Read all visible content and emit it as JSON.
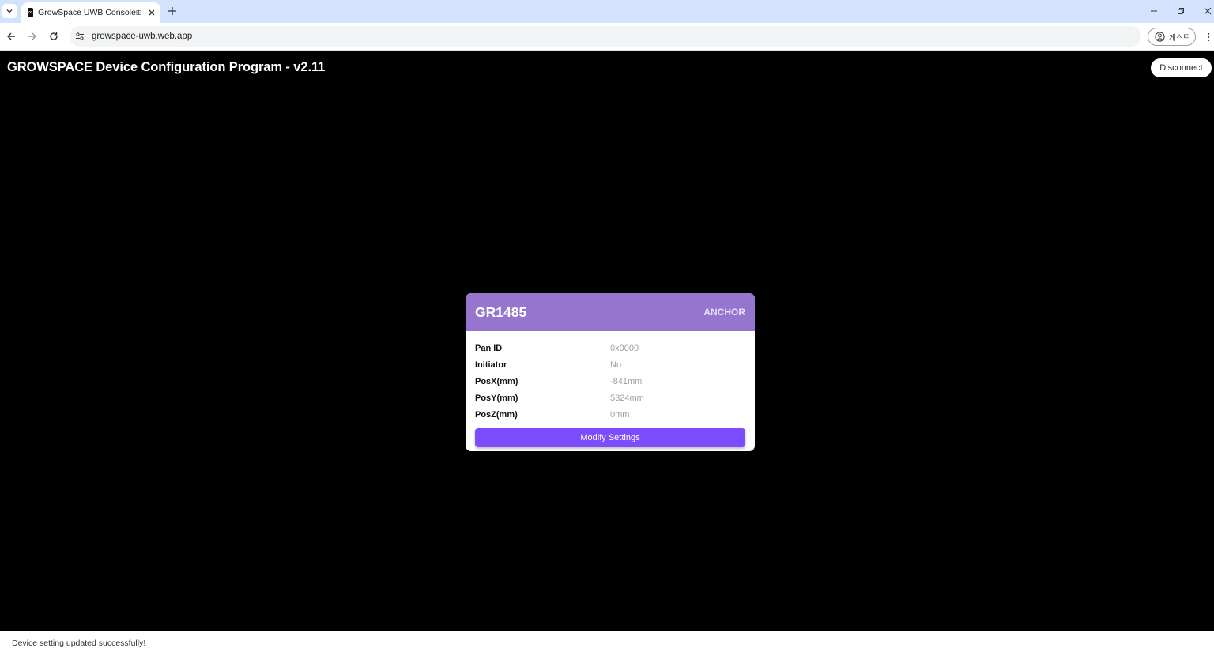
{
  "browser": {
    "tab_title": "GrowSpace UWB Console",
    "url": "growspace-uwb.web.app",
    "profile_label": "게스트",
    "favicon_glyph": "∞"
  },
  "app": {
    "title": "GROWSPACE Device Configuration Program - v2.11",
    "disconnect_label": "Disconnect"
  },
  "device": {
    "id": "GR1485",
    "role": "ANCHOR",
    "fields": [
      {
        "label": "Pan ID",
        "value": "0x0000"
      },
      {
        "label": "Initiator",
        "value": "No"
      },
      {
        "label": "PosX(mm)",
        "value": "-841mm"
      },
      {
        "label": "PosY(mm)",
        "value": "5324mm"
      },
      {
        "label": "PosZ(mm)",
        "value": "0mm"
      }
    ],
    "modify_label": "Modify Settings"
  },
  "snackbar": {
    "message": "Device setting updated successfully!"
  },
  "colors": {
    "card_header": "#9575cd",
    "primary_button": "#7c4dff",
    "tabbar": "#d3e3fd"
  }
}
